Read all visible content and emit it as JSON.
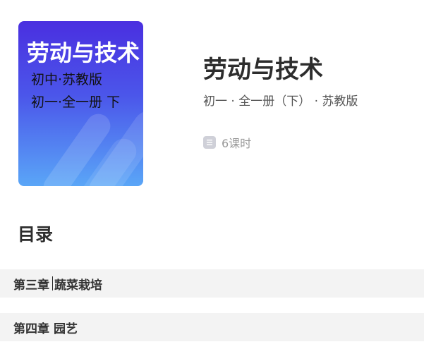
{
  "book": {
    "cover_title": "劳动与技术",
    "cover_line1": "初中·苏教版",
    "cover_line2": "初一·全一册 下",
    "title": "劳动与技术",
    "subtitle": "初一 · 全一册（下） · 苏教版",
    "lessons": "6课时",
    "lessons_icon": "document-icon"
  },
  "toc": {
    "heading": "目录",
    "chapters": [
      {
        "prefix": "第三章",
        "name": "蔬菜栽培",
        "has_caret": true
      },
      {
        "prefix": "第四章",
        "name": "园艺"
      }
    ]
  }
}
